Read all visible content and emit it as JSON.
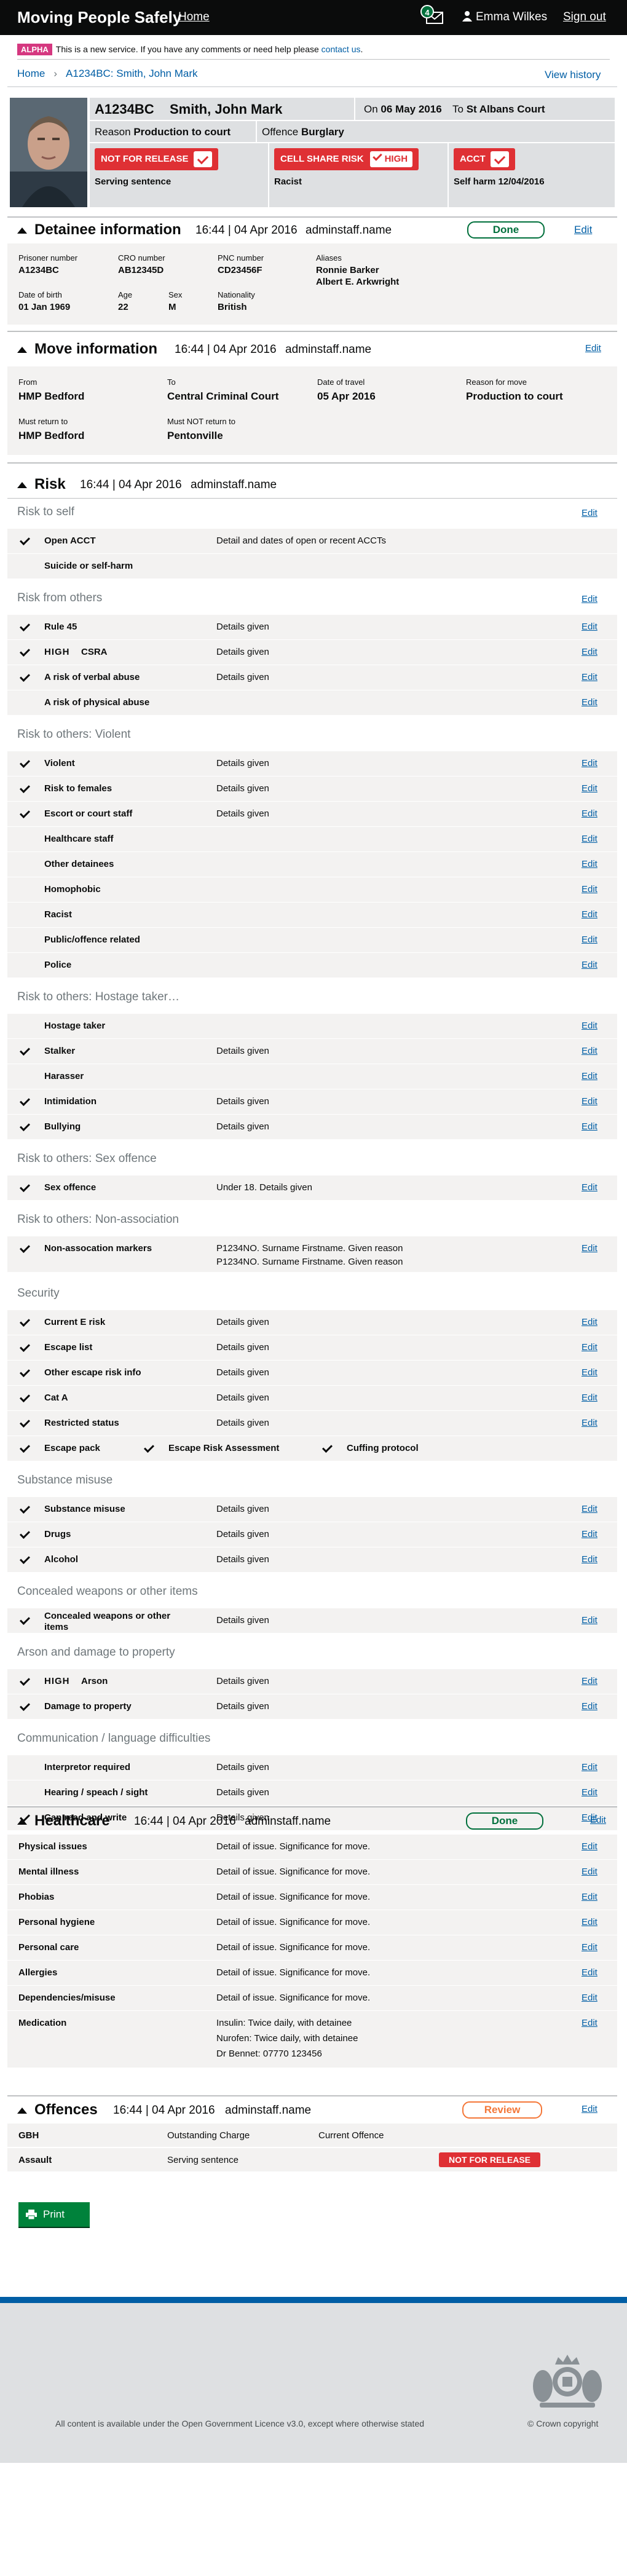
{
  "header": {
    "title": "Moving People Safely",
    "home": "Home",
    "mail_count": "4",
    "user": "Emma Wilkes",
    "signout": "Sign out"
  },
  "beta": {
    "tag": "ALPHA",
    "text": "This is a new service. If you have any comments or need help please ",
    "link": "contact us",
    "end": "."
  },
  "breadcrumb": {
    "home": "Home",
    "current": "A1234BC: Smith, John Mark",
    "view_history": "View history"
  },
  "prisoner": {
    "number": "A1234BC",
    "name": "Smith, John Mark",
    "on_label": "On",
    "on_date": "06 May 2016",
    "to_label": "To",
    "to_place": "St Albans Court",
    "reason_label": "Reason",
    "reason": "Production to court",
    "offence_label": "Offence",
    "offence": "Burglary",
    "flags": [
      {
        "label": "NOT FOR RELEASE",
        "sub": "Serving sentence"
      },
      {
        "label": "CELL SHARE RISK",
        "extra": "HIGH",
        "sub": "Racist"
      },
      {
        "label": "ACCT",
        "sub": "Self harm 12/04/2016"
      }
    ]
  },
  "detainee": {
    "title": "Detainee information",
    "meta": "16:44 | 04 Apr 2016",
    "user": "adminstaff.name",
    "done": "Done",
    "edit": "Edit",
    "fields": [
      {
        "label": "Prisoner number",
        "value": "A1234BC"
      },
      {
        "label": "CRO number",
        "value": "AB12345D"
      },
      {
        "label": "PNC number",
        "value": "CD23456F"
      },
      {
        "label": "Aliases",
        "value": "Ronnie Barker"
      },
      {
        "label": "",
        "value": "Albert E. Arkwright"
      },
      {
        "label": "Date of birth",
        "value": "01 Jan 1969"
      },
      {
        "label": "Age",
        "value": "22"
      },
      {
        "label": "Sex",
        "value": "M"
      },
      {
        "label": "Nationality",
        "value": "British"
      }
    ]
  },
  "move": {
    "title": "Move information",
    "meta": "16:44 | 04 Apr 2016",
    "user": "adminstaff.name",
    "edit": "Edit",
    "fields": [
      {
        "label": "From",
        "value": "HMP Bedford"
      },
      {
        "label": "To",
        "value": "Central Criminal Court"
      },
      {
        "label": "Date of travel",
        "value": "05 Apr 2016"
      },
      {
        "label": "Reason for move",
        "value": "Production to court"
      },
      {
        "label": "Must return to",
        "value": "HMP Bedford"
      },
      {
        "label": "Must NOT return to",
        "value": "Pentonville"
      }
    ]
  },
  "risk": {
    "title": "Risk",
    "meta": "16:44 | 04 Apr 2016",
    "user": "adminstaff.name",
    "edit": "Edit",
    "groups": [
      {
        "title": "Risk to self",
        "items": [
          {
            "name": "Open ACCT",
            "checked": true,
            "detail": "Detail and dates of open or recent ACCTs",
            "edit": ""
          },
          {
            "name": "Suicide or self-harm",
            "checked": false,
            "detail": "",
            "edit": ""
          }
        ]
      },
      {
        "title": "Risk from others",
        "items": [
          {
            "name": "Rule 45",
            "checked": true,
            "detail": "Details given",
            "edit": "Edit"
          },
          {
            "name": "CSRA",
            "checked": true,
            "high": "HIGH",
            "detail": "Details given",
            "edit": "Edit"
          },
          {
            "name": "A risk of verbal abuse",
            "checked": true,
            "detail": "Details given",
            "edit": "Edit"
          },
          {
            "name": "A risk of physical abuse",
            "checked": false,
            "detail": "",
            "edit": "Edit"
          }
        ]
      },
      {
        "title": "Risk to others: Violent",
        "items": [
          {
            "name": "Violent",
            "checked": true,
            "detail": "Details given",
            "edit": "Edit"
          },
          {
            "name": "Risk to females",
            "checked": true,
            "detail": "Details given",
            "edit": "Edit"
          },
          {
            "name": "Escort or court staff",
            "checked": true,
            "detail": "Details given",
            "edit": "Edit"
          },
          {
            "name": "Healthcare staff",
            "checked": false,
            "detail": "",
            "edit": "Edit"
          },
          {
            "name": "Other detainees",
            "checked": false,
            "detail": "",
            "edit": "Edit"
          },
          {
            "name": "Homophobic",
            "checked": false,
            "detail": "",
            "edit": "Edit"
          },
          {
            "name": "Racist",
            "checked": false,
            "detail": "",
            "edit": "Edit"
          },
          {
            "name": "Public/offence related",
            "checked": false,
            "detail": "",
            "edit": "Edit"
          },
          {
            "name": "Police",
            "checked": false,
            "detail": "",
            "edit": "Edit"
          }
        ]
      },
      {
        "title": "Risk to others: Hostage taker…",
        "items": [
          {
            "name": "Hostage taker",
            "checked": false,
            "detail": "",
            "edit": "Edit"
          },
          {
            "name": "Stalker",
            "checked": true,
            "detail": "Details given",
            "edit": "Edit"
          },
          {
            "name": "Harasser",
            "checked": false,
            "detail": "",
            "edit": "Edit"
          },
          {
            "name": "Intimidation",
            "checked": true,
            "detail": "Details given",
            "edit": "Edit"
          },
          {
            "name": "Bullying",
            "checked": true,
            "detail": "Details given",
            "edit": "Edit"
          }
        ]
      },
      {
        "title": "Risk to others: Sex offence",
        "items": [
          {
            "name": "Sex offence",
            "checked": true,
            "detail": "Under 18. Details given",
            "edit": "Edit"
          }
        ]
      },
      {
        "title": "Risk to others: Non-association",
        "items": [
          {
            "name": "Non-assocation markers",
            "checked": true,
            "detail": "P1234NO. Surname Firstname. Given reason",
            "detail2": "P1234NO. Surname Firstname. Given reason",
            "edit": "Edit"
          }
        ]
      },
      {
        "title": "Security",
        "items": [
          {
            "name": "Current E risk",
            "checked": true,
            "detail": "Details given",
            "edit": "Edit"
          },
          {
            "name": "Escape list",
            "checked": true,
            "detail": "Details given",
            "edit": "Edit"
          },
          {
            "name": "Other escape risk info",
            "checked": true,
            "detail": "Details given",
            "edit": "Edit"
          },
          {
            "name": "Cat A",
            "checked": true,
            "detail": "Details given",
            "edit": "Edit"
          },
          {
            "name": "Restricted status",
            "checked": true,
            "detail": "Details given",
            "edit": "Edit"
          }
        ],
        "tri": [
          "Escape pack",
          "Escape Risk Assessment",
          "Cuffing protocol"
        ]
      },
      {
        "title": "Substance misuse",
        "items": [
          {
            "name": "Substance misuse",
            "checked": true,
            "detail": "Details given",
            "edit": "Edit"
          },
          {
            "name": "Drugs",
            "checked": true,
            "detail": "Details given",
            "edit": "Edit"
          },
          {
            "name": "Alcohol",
            "checked": true,
            "detail": "Details given",
            "edit": "Edit"
          }
        ]
      },
      {
        "title": "Concealed weapons or other items",
        "items": [
          {
            "name": "Concealed weapons or other items",
            "checked": true,
            "detail": "Details given",
            "edit": "Edit"
          }
        ]
      },
      {
        "title": "Arson and damage to property",
        "items": [
          {
            "name": "Arson",
            "checked": true,
            "high": "HIGH",
            "detail": "Details given",
            "edit": "Edit"
          },
          {
            "name": "Damage to property",
            "checked": true,
            "detail": "Details given",
            "edit": "Edit"
          }
        ]
      },
      {
        "title": "Communication / language difficulties",
        "items": [
          {
            "name": "Interpretor required",
            "checked": false,
            "detail": "Details given",
            "edit": "Edit"
          },
          {
            "name": "Hearing / speach / sight",
            "checked": false,
            "detail": "Details given",
            "edit": "Edit"
          },
          {
            "name": "Can read and write",
            "checked": true,
            "detail": "Details given",
            "edit": "Edit"
          }
        ]
      }
    ]
  },
  "healthcare": {
    "title": "Healthcare",
    "meta": "16:44 | 04 Apr 2016",
    "user": "adminstaff.name",
    "done": "Done",
    "edit": "Edit",
    "items": [
      {
        "name": "Physical issues",
        "detail": "Detail of issue. Significance for move.",
        "edit": "Edit"
      },
      {
        "name": "Mental illness",
        "detail": "Detail of issue. Significance for move.",
        "edit": "Edit"
      },
      {
        "name": "Phobias",
        "detail": "Detail of issue. Significance for move.",
        "edit": "Edit"
      },
      {
        "name": "Personal hygiene",
        "detail": "Detail of issue. Significance for move.",
        "edit": "Edit"
      },
      {
        "name": "Personal care",
        "detail": "Detail of issue. Significance for move.",
        "edit": "Edit"
      },
      {
        "name": "Allergies",
        "detail": "Detail of issue. Significance for move.",
        "edit": "Edit"
      },
      {
        "name": "Dependencies/misuse",
        "detail": "Detail of issue. Significance for move.",
        "edit": "Edit"
      }
    ],
    "medication": {
      "name": "Medication",
      "lines": [
        "Insulin: Twice daily, with detainee",
        "Nurofen: Twice daily, with detainee",
        "Dr Bennet: 07770 123456"
      ],
      "edit": "Edit"
    }
  },
  "offences": {
    "title": "Offences",
    "meta": "16:44 | 04 Apr 2016",
    "user": "adminstaff.name",
    "review": "Review",
    "edit": "Edit",
    "rows": [
      {
        "name": "GBH",
        "status": "Outstanding Charge",
        "extra": "Current Offence"
      },
      {
        "name": "Assault",
        "status": "Serving sentence",
        "badge": "NOT FOR RELEASE"
      }
    ]
  },
  "print": "Print",
  "footer": {
    "text": "All content is available under the ",
    "link": "Open Government Licence v3.0",
    "end": ", except where otherwise stated",
    "copyright": "© Crown copyright"
  },
  "colors": {
    "accent": "#005ea5",
    "danger": "#df3034",
    "success": "#00703c",
    "review": "#f47738",
    "alpha": "#d53880"
  }
}
